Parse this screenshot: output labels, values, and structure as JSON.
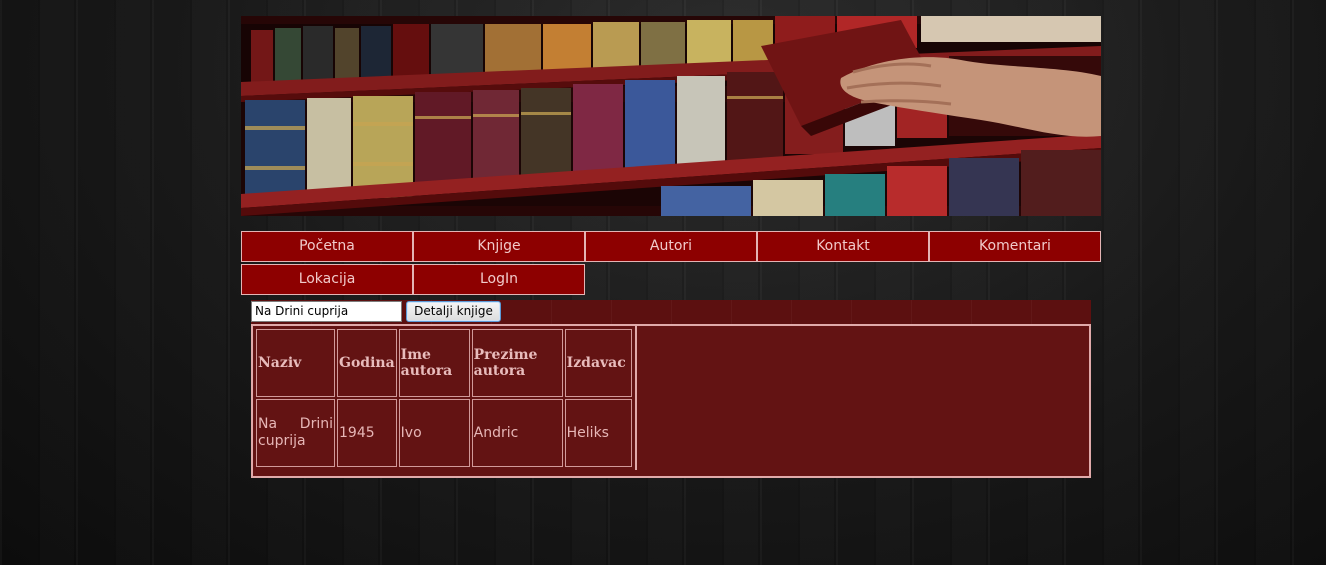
{
  "nav": {
    "items": [
      {
        "label": "Početna"
      },
      {
        "label": "Knjige"
      },
      {
        "label": "Autori"
      },
      {
        "label": "Kontakt"
      },
      {
        "label": "Komentari"
      },
      {
        "label": "Lokacija"
      },
      {
        "label": "LogIn"
      }
    ]
  },
  "search": {
    "value": "Na Drini cuprija",
    "button_label": "Detalji knjige"
  },
  "table": {
    "headers": [
      "Naziv",
      "Godina",
      "Ime autora",
      "Prezime autora",
      "Izdavac"
    ],
    "rows": [
      [
        "Na Drini cuprija",
        "1945",
        "Ivo",
        "Andric",
        "Heliks"
      ]
    ]
  },
  "colors": {
    "nav_background": "#8d0000",
    "nav_text": "#f1caca",
    "panel_background": "#5c1010",
    "table_border": "#e0aaaa",
    "page_background": "#151515"
  }
}
